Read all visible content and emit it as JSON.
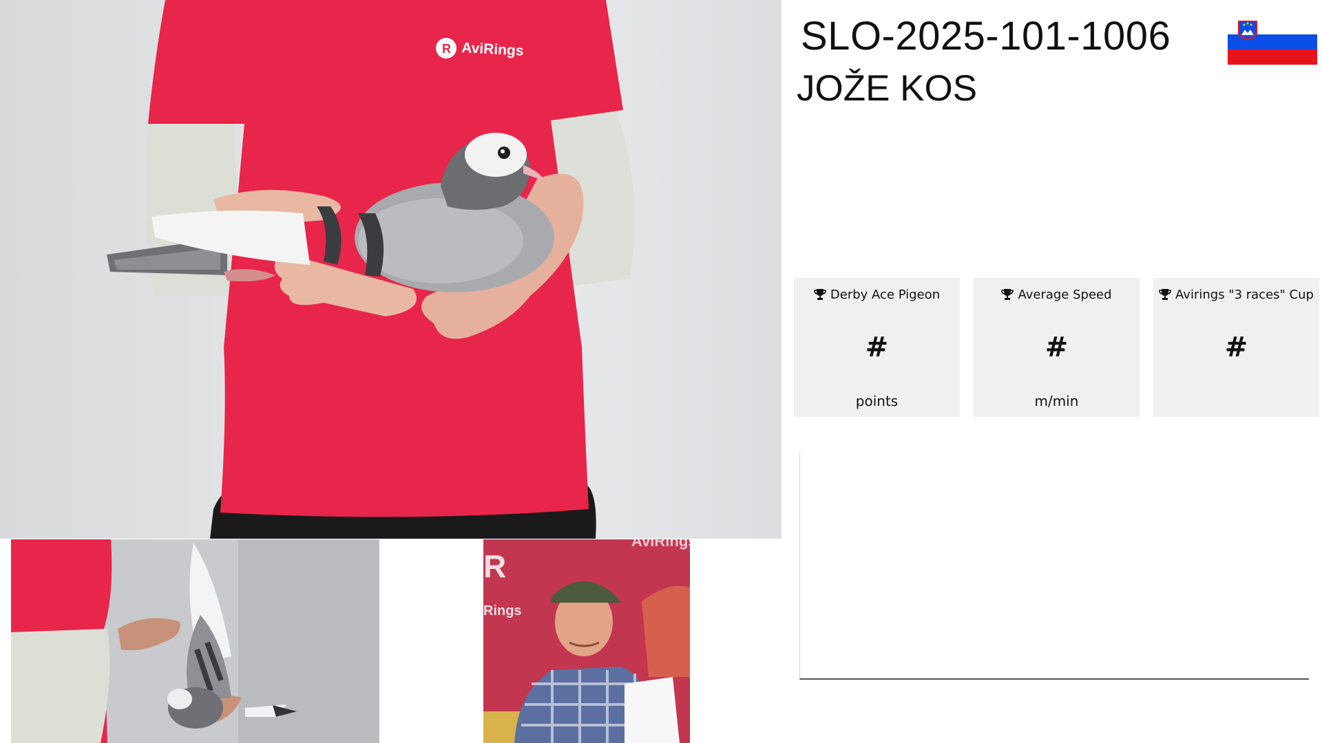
{
  "pigeon": {
    "ring_number": "SLO-2025-101-1006",
    "owner": "JOŽE KOS"
  },
  "flag": {
    "country": "Slovenia",
    "colors": [
      "#ffffff",
      "#0b4ee6",
      "#e8121c"
    ]
  },
  "photos": {
    "main": {
      "shirt_logo_text": "AviRings"
    },
    "wing_thumb": {},
    "owner_thumb": {
      "banner_text": "AviRings"
    }
  },
  "stats": [
    {
      "title": "Derby Ace Pigeon",
      "icon": "trophy-icon",
      "value": "#",
      "unit": "points"
    },
    {
      "title": "Average Speed",
      "icon": "trophy-icon",
      "value": "#",
      "unit": "m/min"
    },
    {
      "title": "Avirings \"3 races\" Cup",
      "icon": "trophy-icon",
      "value": "#",
      "unit": ""
    }
  ],
  "colors": {
    "shirt": "#e8254a",
    "card_bg": "#f0f0f0",
    "text": "#111111"
  }
}
